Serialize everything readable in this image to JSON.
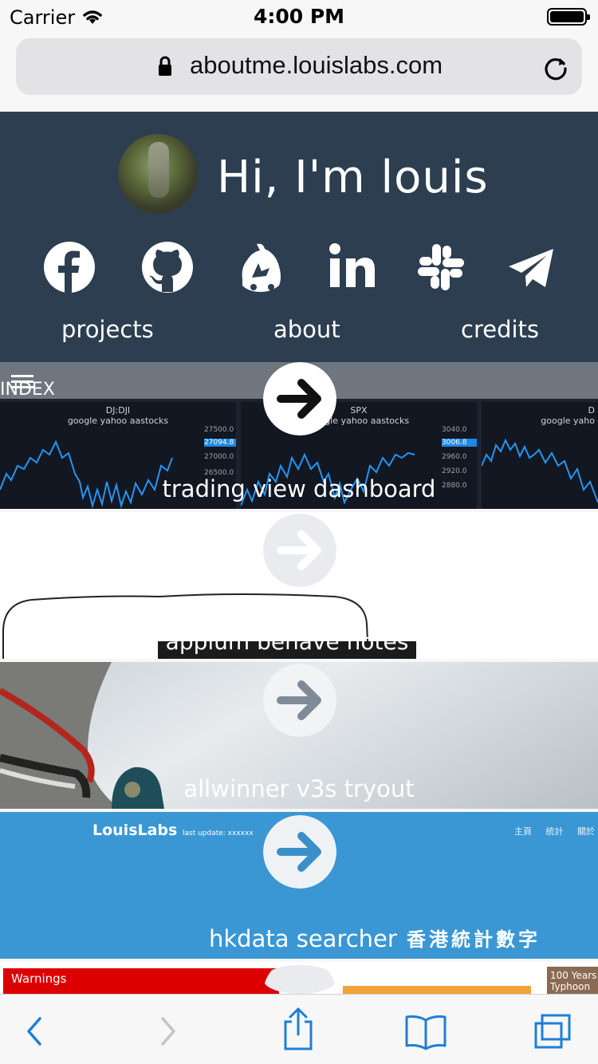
{
  "status_bar": {
    "carrier": "Carrier",
    "time": "4:00 PM"
  },
  "browser": {
    "url": "aboutme.louislabs.com"
  },
  "header": {
    "greeting": "Hi, I'm louis",
    "social_icons": [
      "facebook-icon",
      "github-icon",
      "bitbucket-icon",
      "linkedin-icon",
      "slack-icon",
      "telegram-icon"
    ],
    "nav": [
      "projects",
      "about",
      "credits"
    ]
  },
  "projects": [
    {
      "title": "trading view dashboard",
      "extra": {
        "index_label": "INDEX",
        "panels": [
          {
            "name": "DJ:DJI",
            "sources": "google yahoo aastocks",
            "ticks": [
              "27500.0",
              "27094.8",
              "27000.0",
              "26500.0"
            ]
          },
          {
            "name": "SPX",
            "sources": "google yahoo aastocks",
            "ticks": [
              "3040.0",
              "3006.8",
              "2960.0",
              "2920.0",
              "2880.0"
            ]
          },
          {
            "name": "D",
            "sources": "google yaho"
          }
        ]
      }
    },
    {
      "title": "appium behave notes"
    },
    {
      "title": "allwinner v3s tryout"
    },
    {
      "title": "hkdata searcher",
      "extra": {
        "brand": "LouisLabs",
        "last_update": "last update: xxxxxx",
        "menu": [
          "主頁",
          "統計",
          "關於"
        ],
        "subtitle": "香港統計數字"
      }
    },
    {
      "title": "",
      "extra": {
        "warnings": "Warnings",
        "typhoon": "100 Years Typhoon"
      }
    }
  ],
  "colors": {
    "header_bg": "#2c3e50",
    "ios_blue": "#1e7fd6"
  }
}
